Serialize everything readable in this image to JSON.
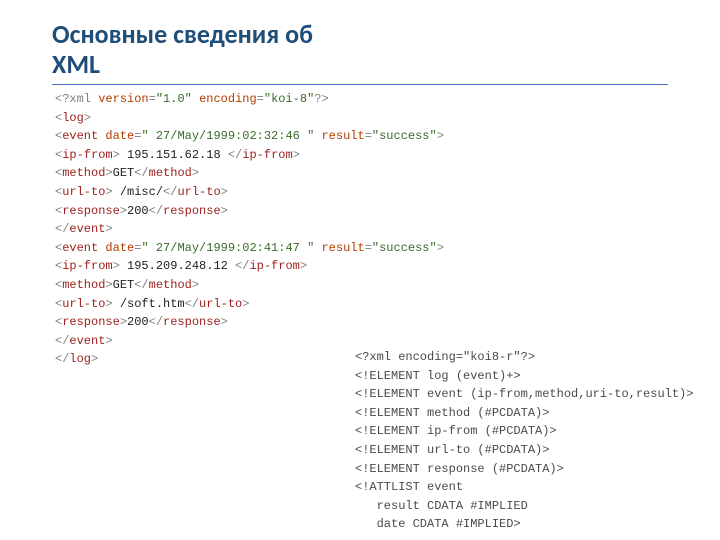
{
  "title_line1": "Основные сведения об",
  "title_line2": "XML",
  "xml": {
    "decl": {
      "open": "<?xml ",
      "attr1": "version",
      "val1": "\"1.0\"",
      "attr2": "encoding",
      "val2": "\"koi-8\"",
      "close": "?>"
    },
    "log_open": {
      "p1": "<",
      "name": "log",
      "p2": ">"
    },
    "ev1_open": {
      "p1": "<",
      "name": "event",
      "a1": "date",
      "v1": "\" 27/May/1999:02:32:46 \"",
      "a2": "result",
      "v2": "\"success\"",
      "p2": ">"
    },
    "ev1_ip": {
      "p1": "<",
      "name": "ip-from",
      "p2": ">",
      "text": " 195.151.62.18 ",
      "p3": "</",
      "p4": ">"
    },
    "ev1_m": {
      "p1": "<",
      "name": "method",
      "p2": ">",
      "text": "GET",
      "p3": "</",
      "p4": ">"
    },
    "ev1_u": {
      "p1": "<",
      "name": "url-to",
      "p2": ">",
      "text": " /misc/",
      "p3": "</",
      "p4": ">"
    },
    "ev1_r": {
      "p1": "<",
      "name": "response",
      "p2": ">",
      "text": "200",
      "p3": "</",
      "p4": ">"
    },
    "ev1_close": {
      "p1": "</",
      "name": "event",
      "p2": ">"
    },
    "ev2_open": {
      "p1": "<",
      "name": "event",
      "a1": "date",
      "v1": "\" 27/May/1999:02:41:47 \"",
      "a2": "result",
      "v2": "\"success\"",
      "p2": ">"
    },
    "ev2_ip": {
      "p1": "<",
      "name": "ip-from",
      "p2": ">",
      "text": " 195.209.248.12 ",
      "p3": "</",
      "p4": ">"
    },
    "ev2_m": {
      "p1": "<",
      "name": "method",
      "p2": ">",
      "text": "GET",
      "p3": "</",
      "p4": ">"
    },
    "ev2_u": {
      "p1": "<",
      "name": "url-to",
      "p2": ">",
      "text": " /soft.htm",
      "p3": "</",
      "p4": ">"
    },
    "ev2_r": {
      "p1": "<",
      "name": "response",
      "p2": ">",
      "text": "200",
      "p3": "</",
      "p4": ">"
    },
    "ev2_close": {
      "p1": "</",
      "name": "event",
      "p2": ">"
    },
    "log_close": {
      "p1": "</",
      "name": "log",
      "p2": ">"
    }
  },
  "dtd": {
    "l1": "<?xml encoding=\"koi8-r\"?>",
    "l2": "<!ELEMENT log (event)+>",
    "l3": "<!ELEMENT event (ip-from,method,uri-to,result)>",
    "l4": "<!ELEMENT method (#PCDATA)>",
    "l5": "<!ELEMENT ip-from (#PCDATA)>",
    "l6": "<!ELEMENT url-to (#PCDATA)>",
    "l7": "<!ELEMENT response (#PCDATA)>",
    "l8": "<!ATTLIST event",
    "l9": "   result CDATA #IMPLIED",
    "l10": "   date CDATA #IMPLIED>"
  }
}
